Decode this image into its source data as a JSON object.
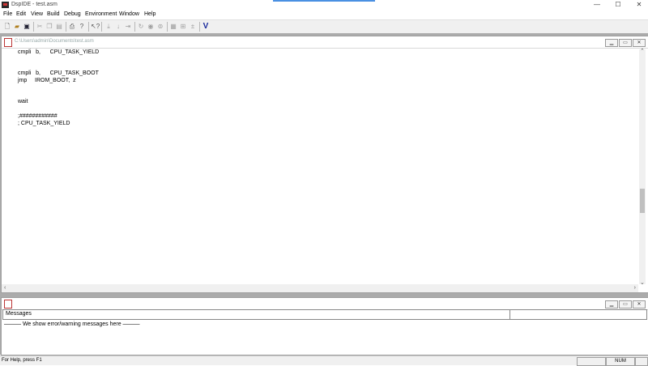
{
  "window": {
    "title": "DspIDE - test.asm",
    "controls": {
      "minimize": "—",
      "maximize": "☐",
      "close": "✕"
    }
  },
  "menu": [
    "File",
    "Edit",
    "View",
    "Build",
    "Debug",
    "Environment",
    "Window",
    "Help"
  ],
  "toolbar": [
    "new-file-icon",
    "open-file-icon",
    "save-icon",
    "cut-icon",
    "copy-icon",
    "paste-icon",
    "print-icon",
    "help-icon",
    "context-help-icon",
    "step-into-icon",
    "step-over-icon",
    "run-to-cursor-icon",
    "restart-icon",
    "stop-icon",
    "reset-icon",
    "memory-icon",
    "registers-icon",
    "disassembly-icon",
    "verify-icon"
  ],
  "verify_button_label": "V",
  "editor": {
    "path": "C:\\Users\\admin\\Documents\\test.asm",
    "lines": [
      "cmpli   b,      CPU_TASK_YIELD",
      "",
      "",
      "cmpli   b,      CPU_TASK_BOOT",
      "jmp     IROM_BOOT,  z",
      "",
      "",
      "wait",
      "",
      ";############",
      "; CPU_TASK_YIELD"
    ]
  },
  "messages": {
    "header": "Messages",
    "text": "——— We show error/warning messages here ———"
  },
  "status": {
    "help": "For Help, press F1",
    "num": "NUM"
  },
  "colors": {
    "accent": "#4a90e2",
    "mdi_background": "#ababab",
    "verify": "#1a2a9c"
  }
}
